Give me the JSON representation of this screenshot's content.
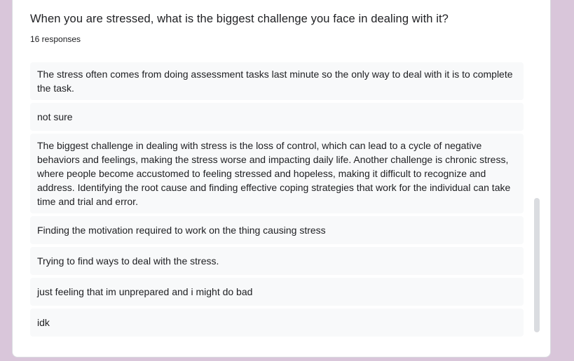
{
  "question": {
    "title": "When you are stressed, what is the biggest challenge you face in dealing with it?",
    "response_count": "16 responses"
  },
  "responses": [
    "The stress often comes from doing assessment tasks last minute so the only way to deal with it is to complete the task.",
    "not sure",
    "The biggest challenge in dealing with stress is the loss of control, which can lead to a cycle of negative behaviors and feelings, making the stress worse and impacting daily life. Another challenge is chronic stress, where people become accustomed to feeling stressed and hopeless, making it difficult to recognize and address. Identifying the root cause and finding effective coping strategies that work for the individual can take time and trial and error.",
    "Finding the motivation required to work on the thing causing stress",
    "Trying to find ways to deal with the stress.",
    "just feeling that im unprepared and i might do bad",
    "idk"
  ],
  "colors": {
    "page_background": "#d9c6da",
    "card_background": "#ffffff",
    "response_background": "#f8f9fa",
    "text": "#202124",
    "scrollbar_thumb": "#dadce0"
  }
}
